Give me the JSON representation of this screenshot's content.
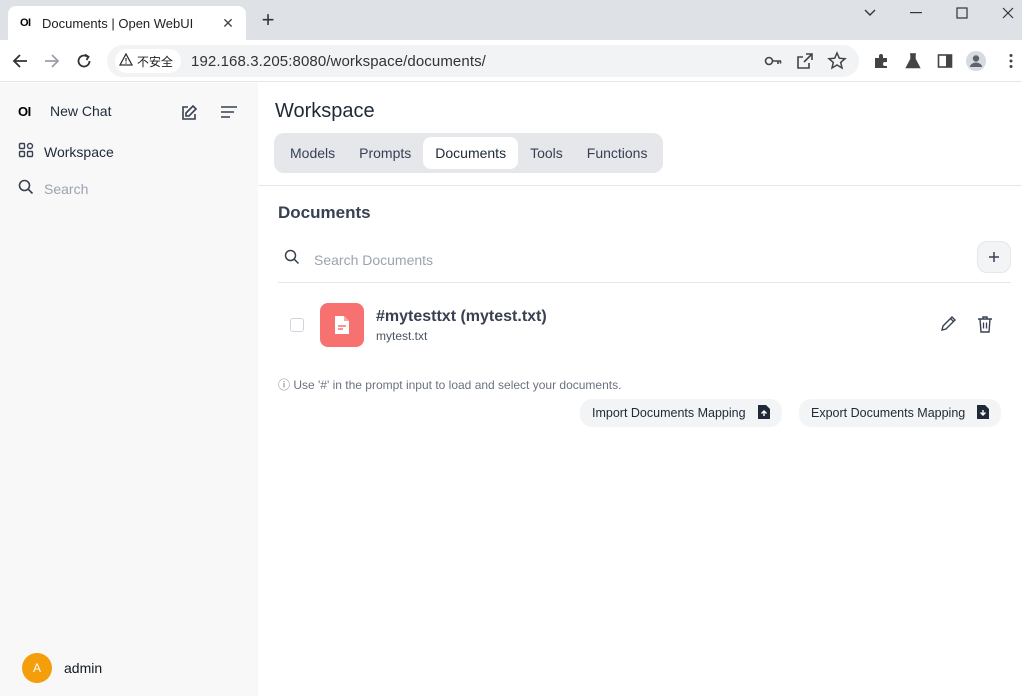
{
  "browser": {
    "tab_title": "Documents | Open WebUI",
    "tab_favicon": "OI",
    "security_label": "不安全",
    "url": "192.168.3.205:8080/workspace/documents/"
  },
  "sidebar": {
    "logo": "OI",
    "new_chat": "New Chat",
    "workspace": "Workspace",
    "search_placeholder": "Search",
    "user_initial": "A",
    "user_name": "admin"
  },
  "main": {
    "title": "Workspace",
    "tabs": [
      "Models",
      "Prompts",
      "Documents",
      "Tools",
      "Functions"
    ],
    "active_tab": "Documents",
    "section_title": "Documents",
    "search_placeholder": "Search Documents",
    "documents": [
      {
        "name": "#mytesttxt (mytest.txt)",
        "filename": "mytest.txt"
      }
    ],
    "hint": "ⓘ Use '#' in the prompt input to load and select your documents.",
    "import_label": "Import Documents Mapping",
    "export_label": "Export Documents Mapping"
  },
  "colors": {
    "accent_avatar": "#f59e0b",
    "file_tile": "#f87171"
  }
}
